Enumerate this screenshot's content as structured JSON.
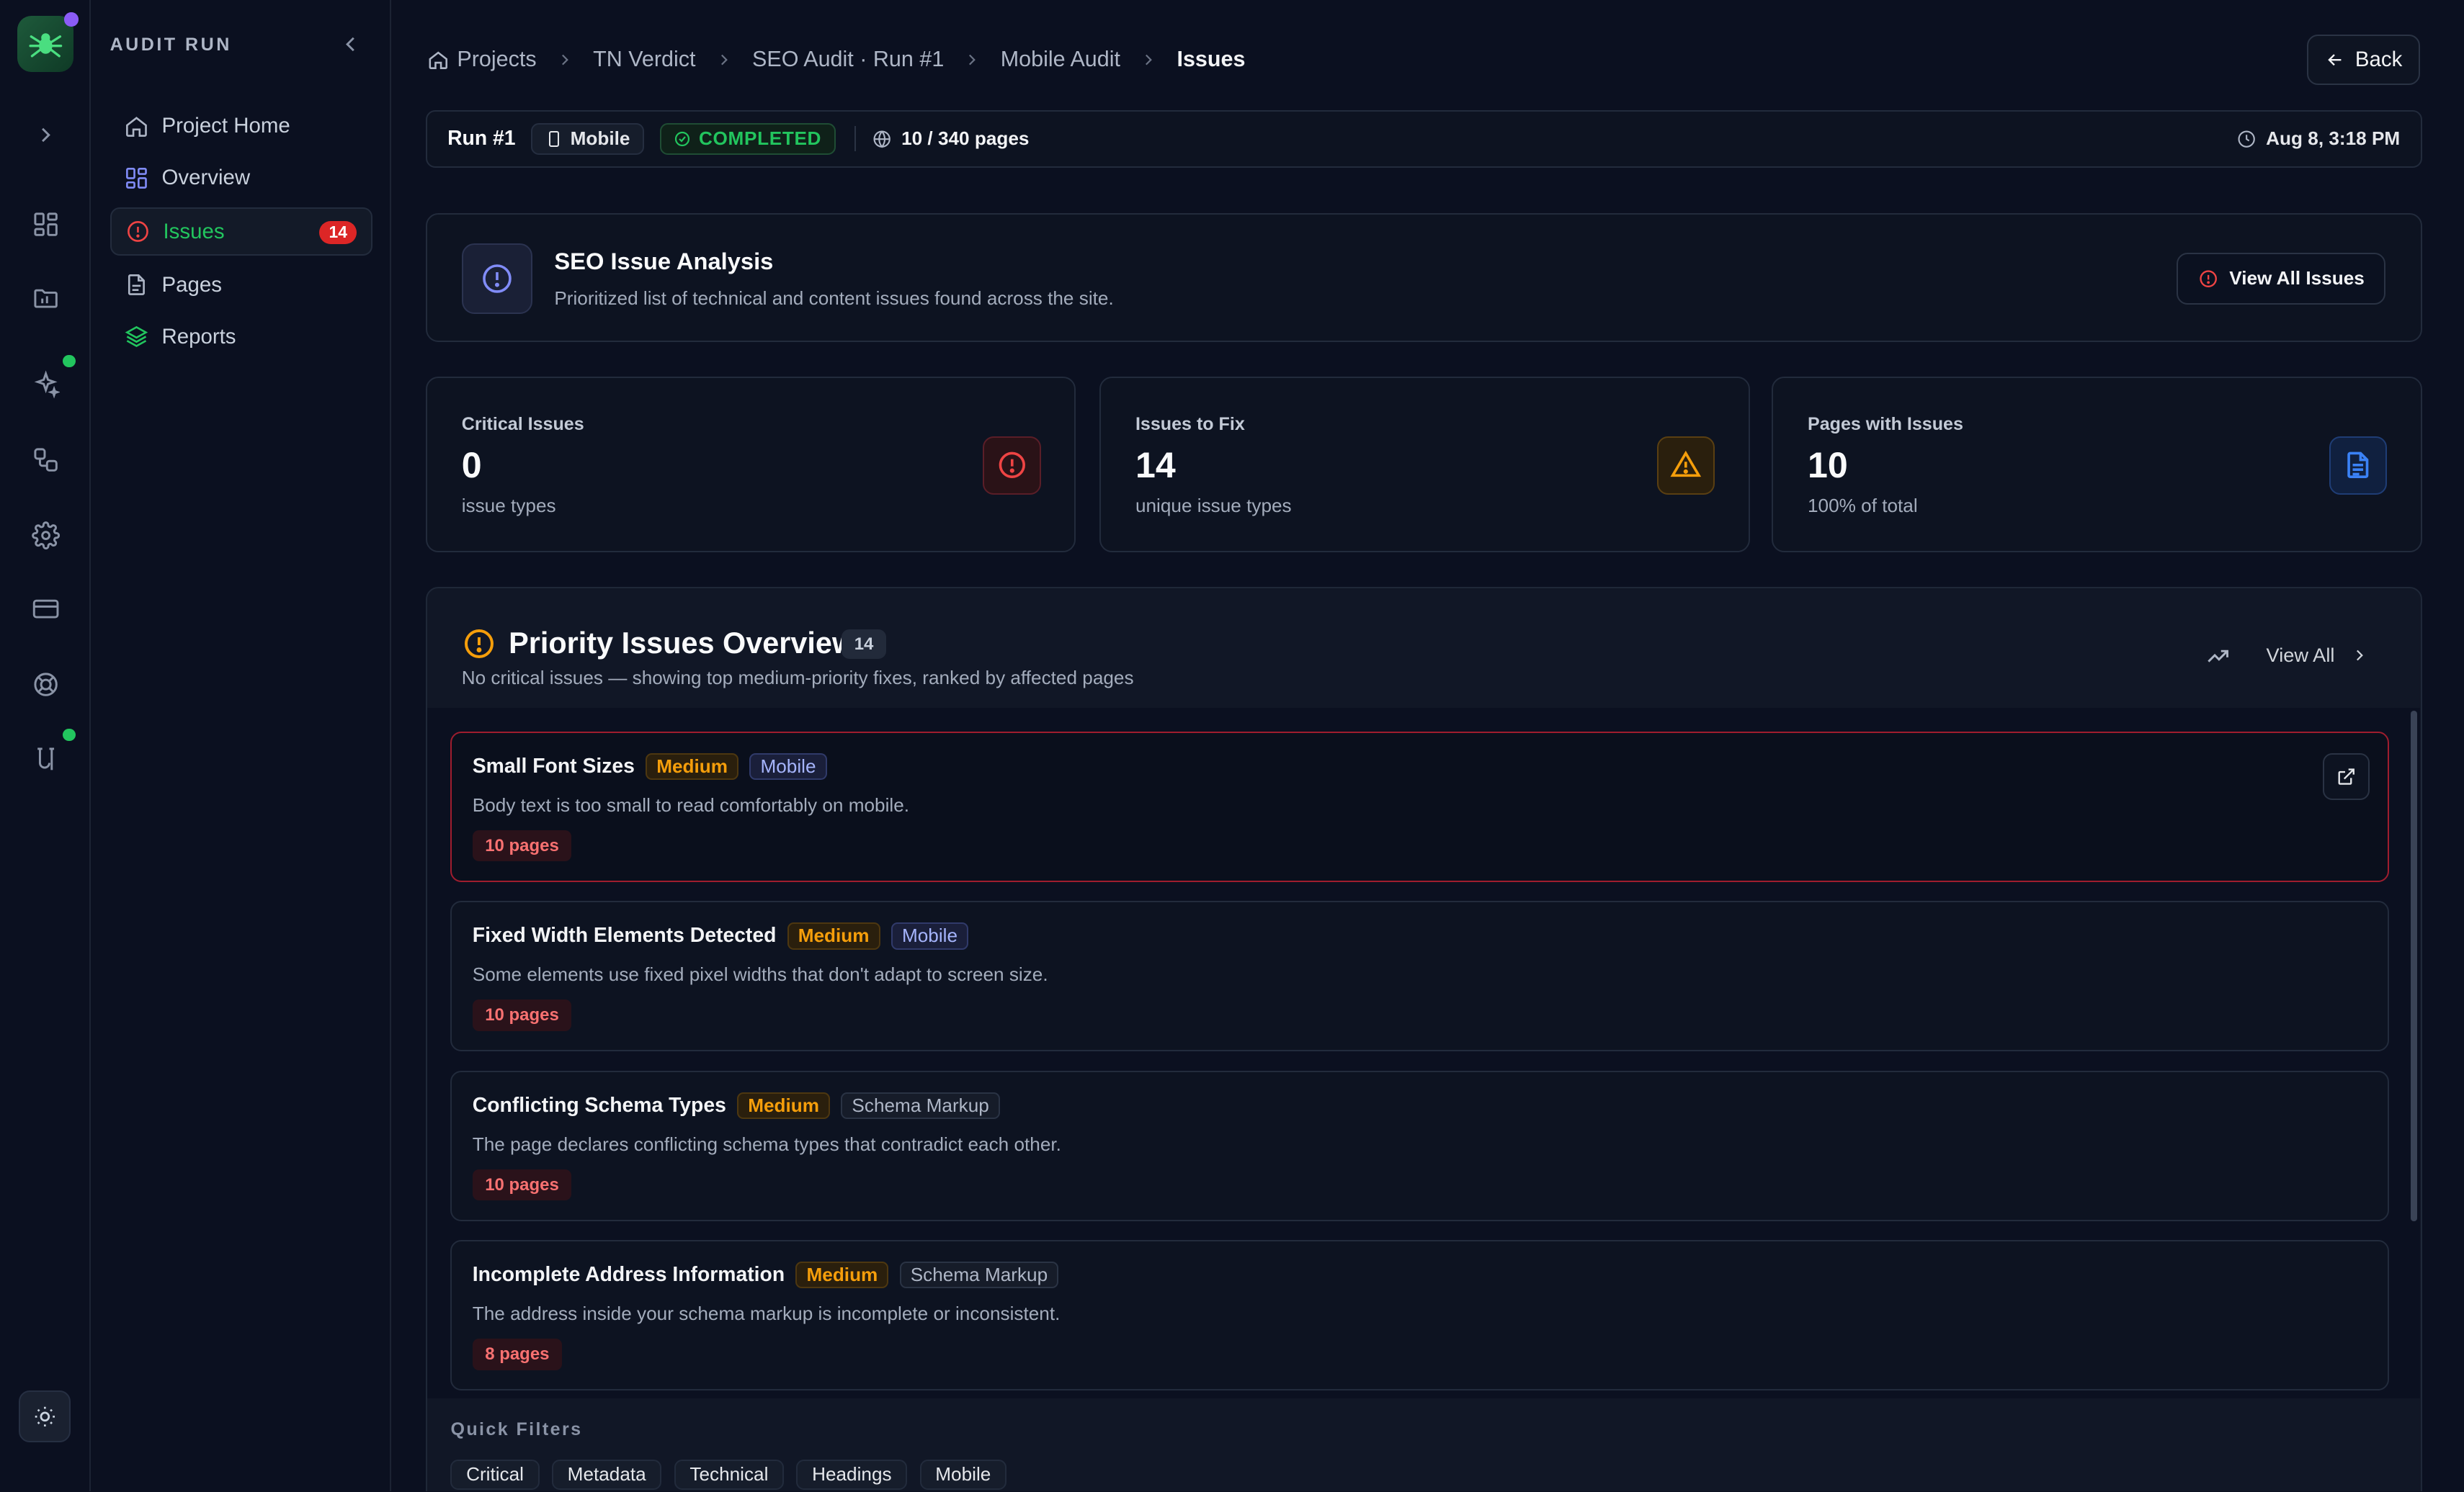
{
  "sidebar": {
    "title": "AUDIT RUN",
    "items": [
      {
        "label": "Project Home",
        "icon": "home-icon"
      },
      {
        "label": "Overview",
        "icon": "grid-icon"
      },
      {
        "label": "Issues",
        "icon": "alert-circle-icon",
        "badge": "14",
        "active": true
      },
      {
        "label": "Pages",
        "icon": "file-icon"
      },
      {
        "label": "Reports",
        "icon": "layers-icon"
      }
    ]
  },
  "breadcrumb": [
    "Projects",
    "TN Verdict",
    "SEO Audit · Run #1",
    "Mobile Audit",
    "Issues"
  ],
  "back_label": "Back",
  "run": {
    "label": "Run #1",
    "device": "Mobile",
    "status": "COMPLETED",
    "pages": "10 / 340 pages",
    "date": "Aug 8, 3:18 PM"
  },
  "analysis": {
    "title": "SEO Issue Analysis",
    "desc": "Prioritized list of technical and content issues found across the site.",
    "button": "View All Issues"
  },
  "stats": [
    {
      "label": "Critical Issues",
      "value": "0",
      "sub": "issue types",
      "color": "#ef4444"
    },
    {
      "label": "Issues to Fix",
      "value": "14",
      "sub": "unique issue types",
      "color": "#f59e0b"
    },
    {
      "label": "Pages with Issues",
      "value": "10",
      "sub": "100% of total",
      "color": "#3b82f6"
    }
  ],
  "priority": {
    "title": "Priority Issues Overview",
    "count": "14",
    "subtitle": "No critical issues — showing top medium-priority fixes, ranked by affected pages",
    "view_all": "View All",
    "issues": [
      {
        "title": "Small Font Sizes",
        "severity": "Medium",
        "category": "Mobile",
        "desc": "Body text is too small to read comfortably on mobile.",
        "pages": "10 pages"
      },
      {
        "title": "Fixed Width Elements Detected",
        "severity": "Medium",
        "category": "Mobile",
        "desc": "Some elements use fixed pixel widths that don't adapt to screen size.",
        "pages": "10 pages"
      },
      {
        "title": "Conflicting Schema Types",
        "severity": "Medium",
        "category": "Schema Markup",
        "desc": "The page declares conflicting schema types that contradict each other.",
        "pages": "10 pages"
      },
      {
        "title": "Incomplete Address Information",
        "severity": "Medium",
        "category": "Schema Markup",
        "desc": "The address inside your schema markup is incomplete or inconsistent.",
        "pages": "8 pages"
      }
    ]
  },
  "quick_filters": {
    "label": "Quick Filters",
    "items": [
      "Critical",
      "Metadata",
      "Technical",
      "Headings",
      "Mobile"
    ]
  }
}
